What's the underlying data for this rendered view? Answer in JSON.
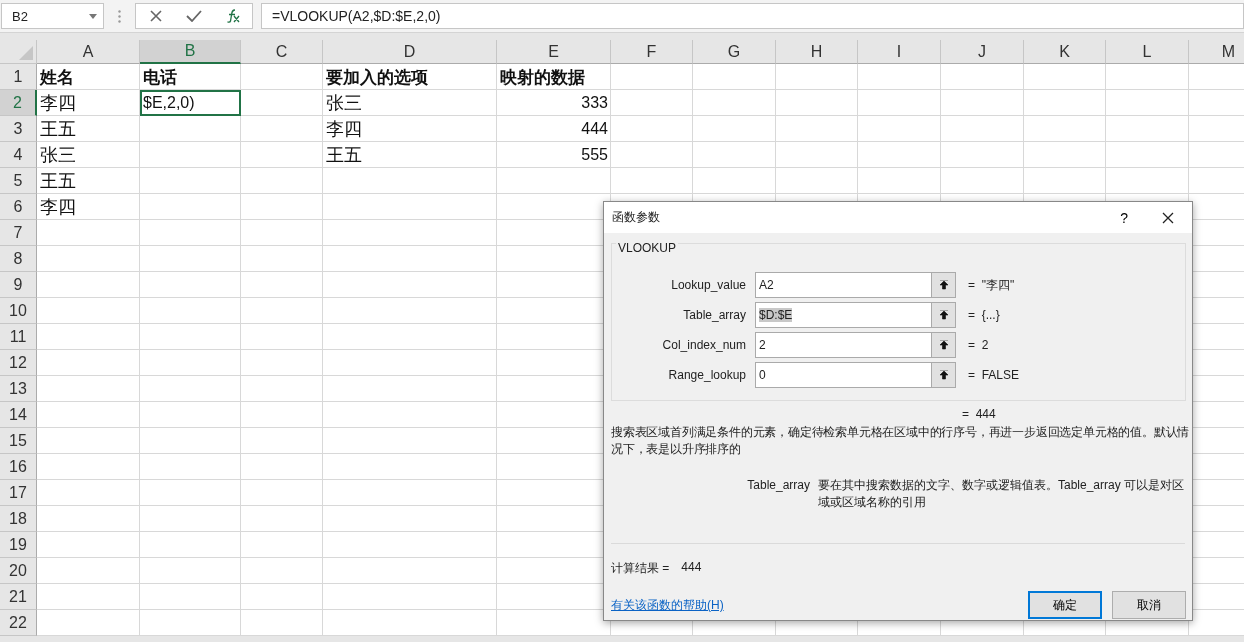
{
  "name_box": "B2",
  "formula_bar": {
    "formula": "=VLOOKUP(A2,$D:$E,2,0)"
  },
  "columns": [
    {
      "label": "A",
      "selected": false
    },
    {
      "label": "B",
      "selected": true
    },
    {
      "label": "C",
      "selected": false
    },
    {
      "label": "D",
      "selected": false
    },
    {
      "label": "E",
      "selected": false
    },
    {
      "label": "F",
      "selected": false
    },
    {
      "label": "G",
      "selected": false
    },
    {
      "label": "H",
      "selected": false
    },
    {
      "label": "I",
      "selected": false
    },
    {
      "label": "J",
      "selected": false
    },
    {
      "label": "K",
      "selected": false
    },
    {
      "label": "L",
      "selected": false
    },
    {
      "label": "M",
      "selected": false
    }
  ],
  "rows": [
    {
      "label": "1",
      "selected": false,
      "cells": {
        "A": {
          "text": "姓名",
          "kind": "header"
        },
        "B": {
          "text": "电话",
          "kind": "header"
        },
        "D": {
          "text": "要加入的选项",
          "kind": "header"
        },
        "E": {
          "text": "映射的数据",
          "kind": "header"
        }
      }
    },
    {
      "label": "2",
      "selected": true,
      "cells": {
        "A": {
          "text": "李四",
          "kind": "text"
        },
        "B": {
          "text": "$E,2,0)",
          "kind": "text",
          "active": true
        },
        "D": {
          "text": "张三",
          "kind": "text"
        },
        "E": {
          "text": "333",
          "kind": "number"
        }
      }
    },
    {
      "label": "3",
      "selected": false,
      "cells": {
        "A": {
          "text": "王五",
          "kind": "text"
        },
        "D": {
          "text": "李四",
          "kind": "text"
        },
        "E": {
          "text": "444",
          "kind": "number"
        }
      }
    },
    {
      "label": "4",
      "selected": false,
      "cells": {
        "A": {
          "text": "张三",
          "kind": "text"
        },
        "D": {
          "text": "王五",
          "kind": "text"
        },
        "E": {
          "text": "555",
          "kind": "number"
        }
      }
    },
    {
      "label": "5",
      "selected": false,
      "cells": {
        "A": {
          "text": "王五",
          "kind": "text"
        }
      }
    },
    {
      "label": "6",
      "selected": false,
      "cells": {
        "A": {
          "text": "李四",
          "kind": "text"
        }
      }
    },
    {
      "label": "7",
      "selected": false
    },
    {
      "label": "8",
      "selected": false
    },
    {
      "label": "9",
      "selected": false
    },
    {
      "label": "10",
      "selected": false
    },
    {
      "label": "11",
      "selected": false
    },
    {
      "label": "12",
      "selected": false
    },
    {
      "label": "13",
      "selected": false
    },
    {
      "label": "14",
      "selected": false
    },
    {
      "label": "15",
      "selected": false
    },
    {
      "label": "16",
      "selected": false
    },
    {
      "label": "17",
      "selected": false
    },
    {
      "label": "18",
      "selected": false
    },
    {
      "label": "19",
      "selected": false
    },
    {
      "label": "20",
      "selected": false
    },
    {
      "label": "21",
      "selected": false
    },
    {
      "label": "22",
      "selected": false
    }
  ],
  "dialog": {
    "title": "函数参数",
    "help": "?",
    "function_name": "VLOOKUP",
    "arguments": [
      {
        "label": "Lookup_value",
        "value": "A2",
        "highlighted": false,
        "result": "=  \"李四\""
      },
      {
        "label": "Table_array",
        "value": "$D:$E",
        "highlighted": true,
        "result": "=  {...}"
      },
      {
        "label": "Col_index_num",
        "value": "2",
        "highlighted": false,
        "result": "=  2"
      },
      {
        "label": "Range_lookup",
        "value": "0",
        "highlighted": false,
        "result": "=  FALSE"
      }
    ],
    "formula_result": "=  444",
    "description": "搜索表区域首列满足条件的元素，确定待检索单元格在区域中的行序号，再进一步返回选定单元格的值。默认情况下，表是以升序排序的",
    "argument_help": {
      "name": "Table_array",
      "text": "要在其中搜索数据的文字、数字或逻辑值表。Table_array 可以是对区域或区域名称的引用"
    },
    "calc_result": {
      "label": "计算结果 =",
      "value": "444"
    },
    "help_link": "有关该函数的帮助(H)",
    "buttons": [
      {
        "label": "确定",
        "default": true
      },
      {
        "label": "取消",
        "default": false
      }
    ]
  }
}
